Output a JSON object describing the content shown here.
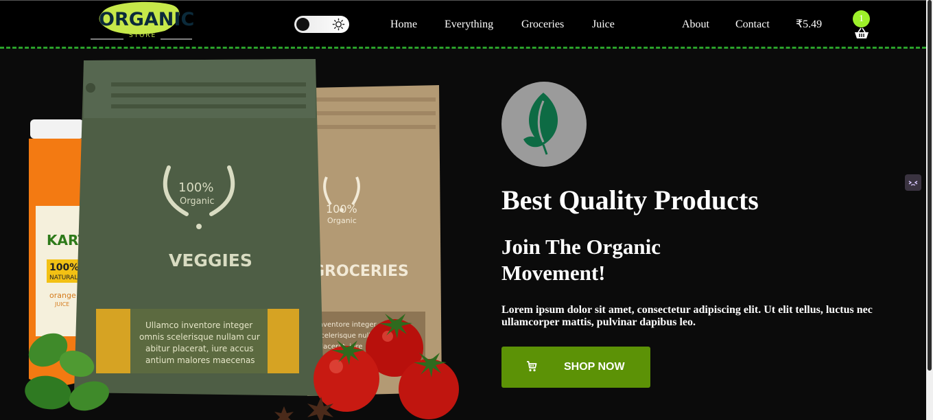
{
  "logo": {
    "brand": "ORGANIC",
    "tagline": "STORE"
  },
  "nav": {
    "items": [
      {
        "label": "Home"
      },
      {
        "label": "Everything"
      },
      {
        "label": "Groceries"
      },
      {
        "label": "Juice"
      },
      {
        "label": "About"
      },
      {
        "label": "Contact"
      }
    ],
    "cart_total": "₹5.49",
    "cart_count": "1"
  },
  "hero": {
    "packages": {
      "veggies": {
        "badge_percent": "100%",
        "badge_word": "Organic",
        "name": "VEGGIES",
        "label_text": [
          "Ullamco inventore integer",
          "omnis scelerisque nullam cur",
          "abitur placerat, iure accus",
          "antium malores maecenas"
        ]
      },
      "groceries": {
        "badge_percent": "100%",
        "badge_word": "Organic",
        "name": "GROCERIES",
        "label_text": [
          "inventore integer",
          "scelerisque nulla",
          "placerat, iure"
        ]
      },
      "juice": {
        "brand": "KARTI",
        "badge": "100%",
        "badge_word": "NATURAL",
        "flavor": "orange",
        "type": "JUICE"
      }
    },
    "title": "Best Quality Products",
    "subtitle": "Join The Organic Movement!",
    "description": "Lorem ipsum dolor sit amet, consectetur adipiscing elit. Ut elit tellus, luctus nec ullamcorper mattis, pulvinar dapibus leo.",
    "cta_label": "SHOP NOW"
  },
  "colors": {
    "accent": "#5c9206",
    "badge": "#9df02a",
    "nav_border": "#2aa22a",
    "leaf": "#0d6b44",
    "veggies_bag": "#4e5e45",
    "groceries_bag": "#b39a74"
  },
  "icons": {
    "theme_toggle": "sun-icon",
    "cart": "shopping-basket-icon",
    "cta": "cart-icon",
    "logo_mark": "leaf-icon"
  }
}
